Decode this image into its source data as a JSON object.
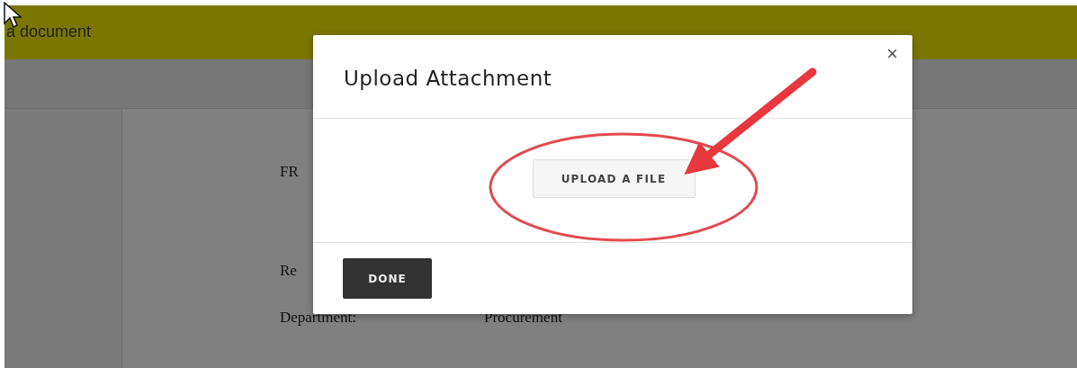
{
  "header": {
    "title": "a document"
  },
  "document": {
    "lines": [
      {
        "label": "FR"
      },
      {
        "label": "Re"
      },
      {
        "label": "Department:",
        "value": "Procurement"
      }
    ]
  },
  "dialog": {
    "title": "Upload Attachment",
    "close": "×",
    "upload_button": "UPLOAD A FILE",
    "done_button": "DONE"
  }
}
